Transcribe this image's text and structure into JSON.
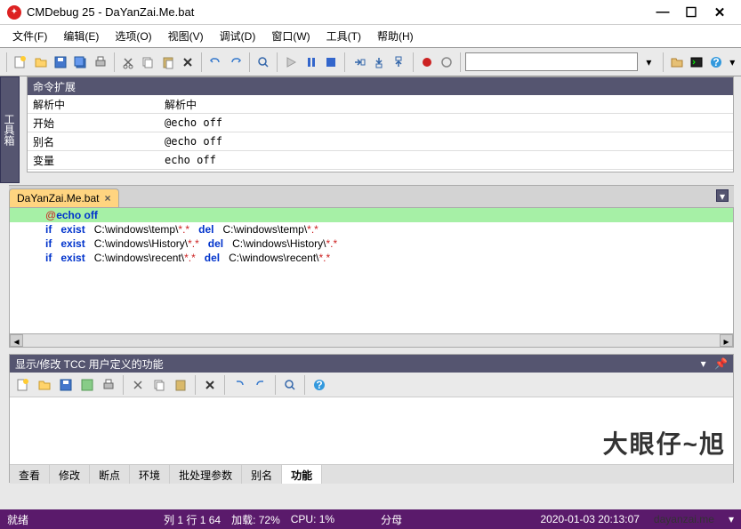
{
  "title": "CMDebug 25 - DaYanZai.Me.bat",
  "menu": [
    "文件(F)",
    "编辑(E)",
    "选项(O)",
    "视图(V)",
    "调试(D)",
    "窗口(W)",
    "工具(T)",
    "帮助(H)"
  ],
  "toolbox_label": "工具箱",
  "cmd_panel": {
    "title": "命令扩展",
    "rows": [
      {
        "k": "解析中",
        "v": "解析中"
      },
      {
        "k": "开始",
        "v": "@echo off"
      },
      {
        "k": "别名",
        "v": "@echo off"
      },
      {
        "k": "变量",
        "v": "echo off"
      }
    ]
  },
  "file_tab": {
    "name": "DaYanZai.Me.bat"
  },
  "code": {
    "line1_a": "@",
    "line1_b": "echo off",
    "line2": "if   exist   C:\\windows\\temp\\*.*   del   C:\\windows\\temp\\*.*",
    "line3": "if   exist   C:\\windows\\History\\*.*   del   C:\\windows\\History\\*.*",
    "line4": "if   exist   C:\\windows\\recent\\*.*   del   C:\\windows\\recent\\*.*"
  },
  "func_panel": {
    "title": "显示/修改 TCC 用户定义的功能",
    "tabs": [
      "查看",
      "修改",
      "断点",
      "环境",
      "批处理参数",
      "别名",
      "功能"
    ]
  },
  "status": {
    "ready": "就绪",
    "pos": "列 1 行 1  64",
    "load": "加载: 72%",
    "cpu": "CPU:  1%",
    "mem": "分母",
    "time": "2020-01-03  20:13:07"
  },
  "watermark": "大眼仔~旭",
  "watermark_url": "dayanzai.me"
}
